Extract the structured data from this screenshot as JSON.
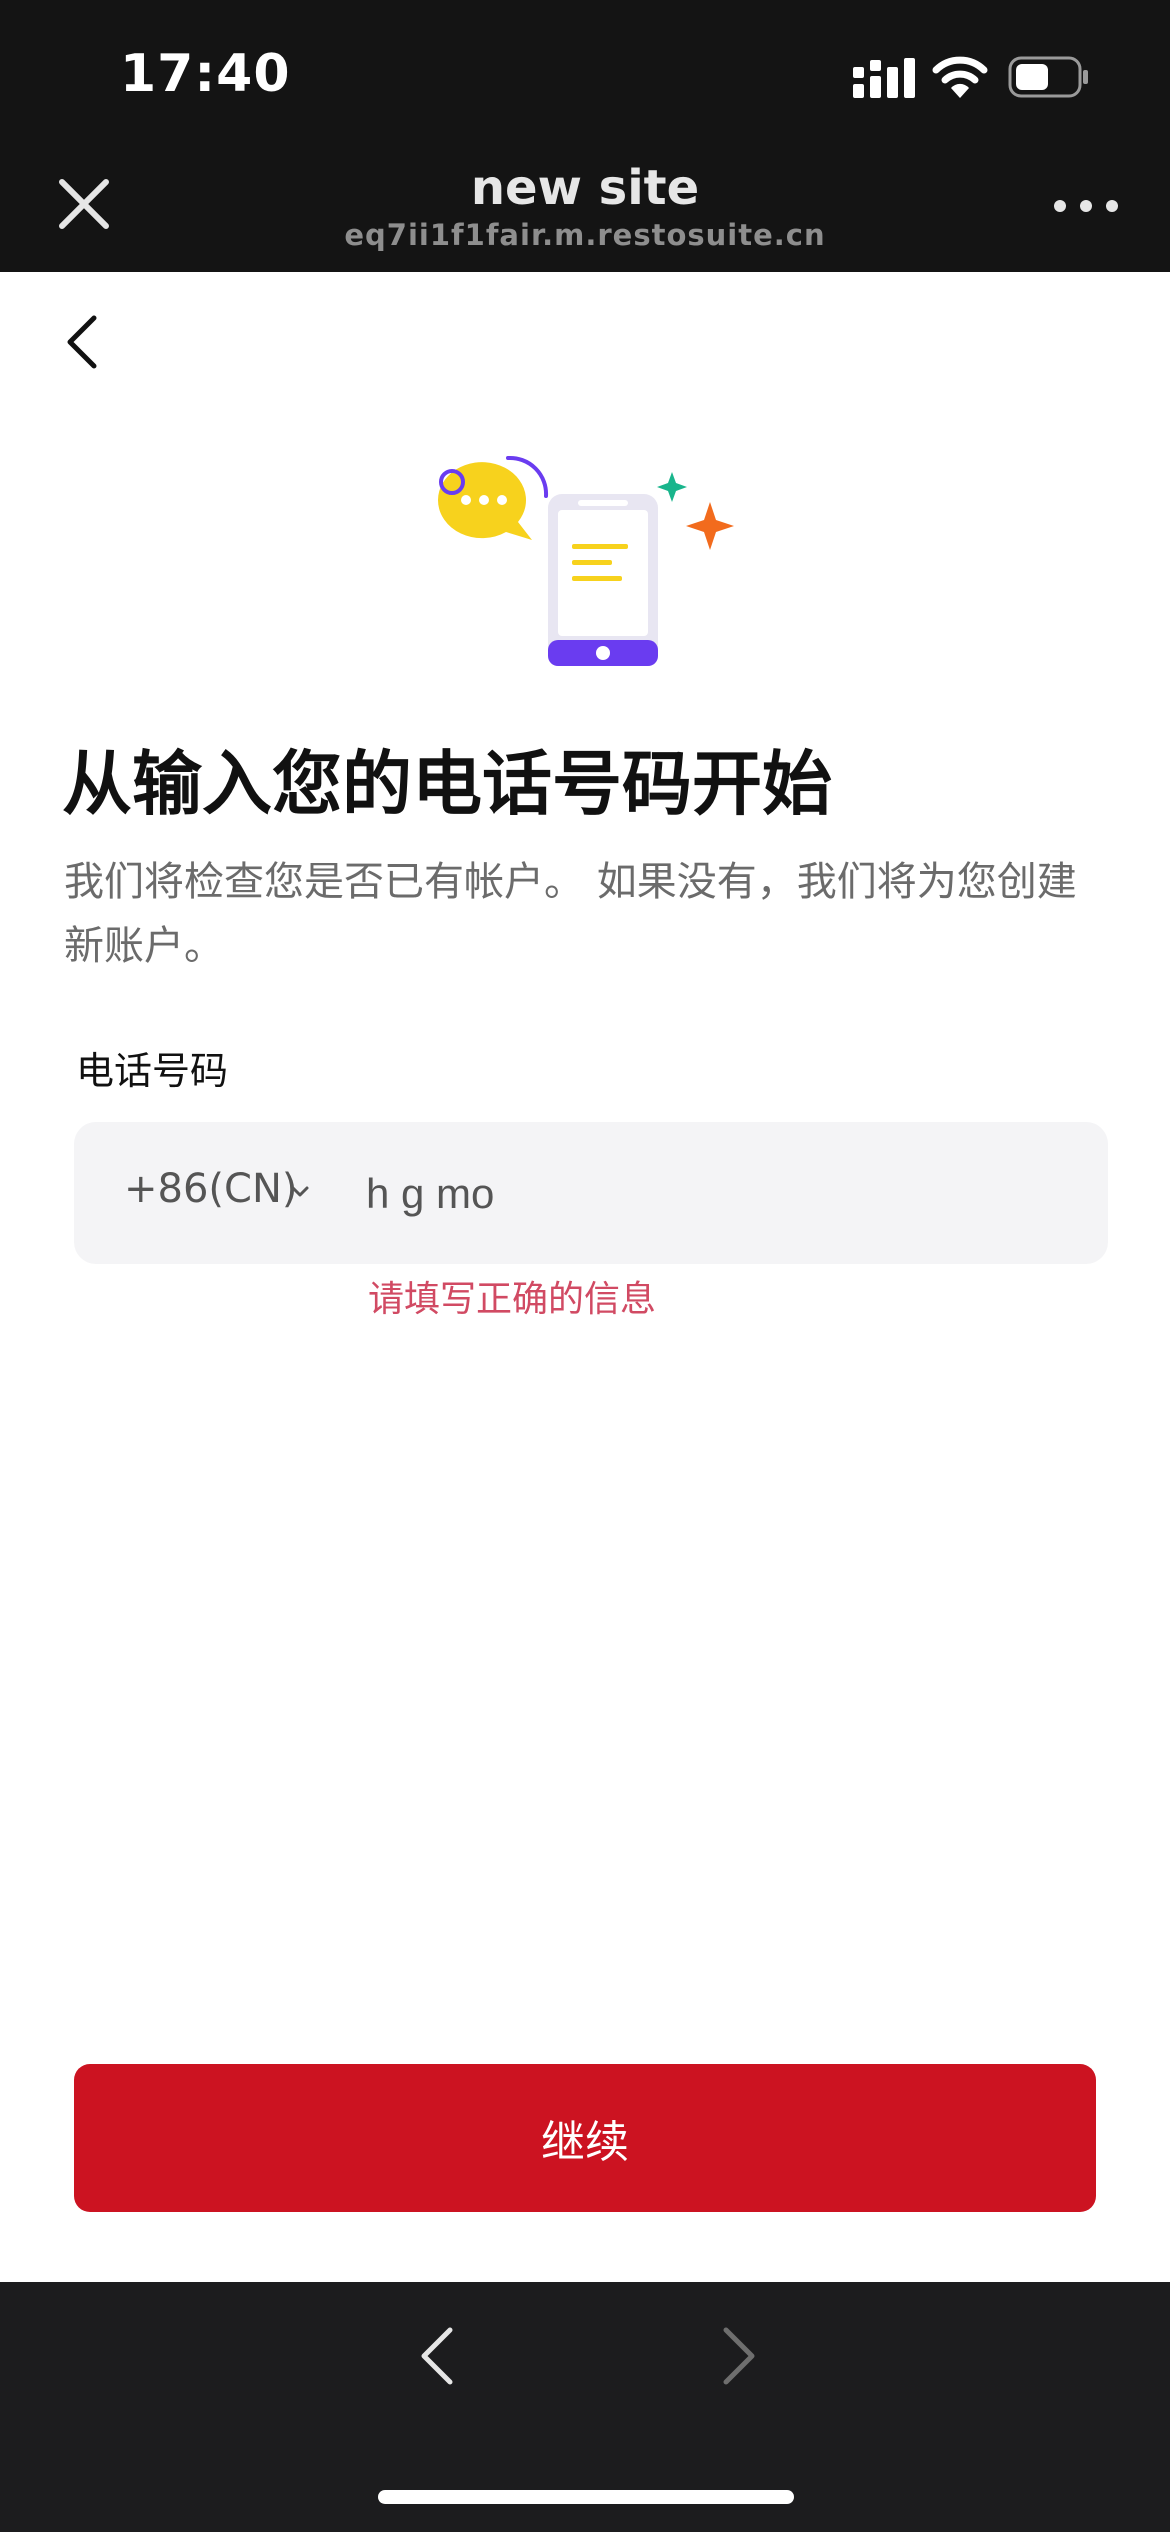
{
  "status_bar": {
    "time": "17:40"
  },
  "browser": {
    "title": "new site",
    "url": "eq7ii1f1fair.m.restosuite.cn"
  },
  "page": {
    "headline": "从输入您的电话号码开始",
    "subtitle": "我们将检查您是否已有帐户。 如果没有，我们将为您创建新账户。",
    "phone_label": "电话号码",
    "country_code": "+86(CN)",
    "phone_value": "h g mo",
    "error": "请填写正确的信息",
    "continue_label": "继续"
  },
  "colors": {
    "primary_button": "#cc1321",
    "error_text": "#d14a63",
    "illustration_accent": "#6a3cf0",
    "chat_bubble": "#f7d21d",
    "sparkle_orange": "#f26b1d",
    "sparkle_green": "#19b58c"
  },
  "icons": {
    "close": "close-icon",
    "more": "more-icon",
    "back": "chevron-left-icon",
    "country_dropdown": "chevron-down-icon",
    "nav_back": "nav-back-icon",
    "nav_forward": "nav-forward-icon"
  }
}
